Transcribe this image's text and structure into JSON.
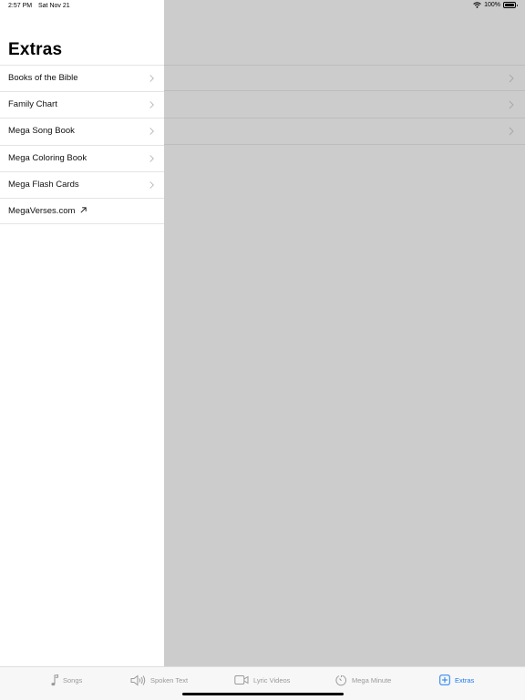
{
  "status_bar": {
    "time": "2:57 PM",
    "date": "Sat Nov 21",
    "battery": "100%"
  },
  "sidebar": {
    "title": "Extras",
    "items": [
      {
        "label": "Books of the Bible",
        "chevron": true
      },
      {
        "label": "Family Chart",
        "chevron": true
      },
      {
        "label": "Mega Song Book",
        "chevron": true
      },
      {
        "label": "Mega Coloring Book",
        "chevron": true
      },
      {
        "label": "Mega Flash Cards",
        "chevron": true
      },
      {
        "label": "MegaVerses.com",
        "external": true
      }
    ]
  },
  "tab_bar": {
    "tabs": [
      {
        "label": "Songs",
        "icon": "music-note-icon",
        "active": false
      },
      {
        "label": "Spoken Text",
        "icon": "speaker-icon",
        "active": false
      },
      {
        "label": "Lyric Videos",
        "icon": "video-camera-icon",
        "active": false
      },
      {
        "label": "Mega Minute",
        "icon": "timer-icon",
        "active": false
      },
      {
        "label": "Extras",
        "icon": "plus-square-icon",
        "active": true
      }
    ]
  },
  "colors": {
    "accent": "#1c7bf0",
    "inactive": "#9a9a9a",
    "dim_overlay": "#cccccc"
  }
}
